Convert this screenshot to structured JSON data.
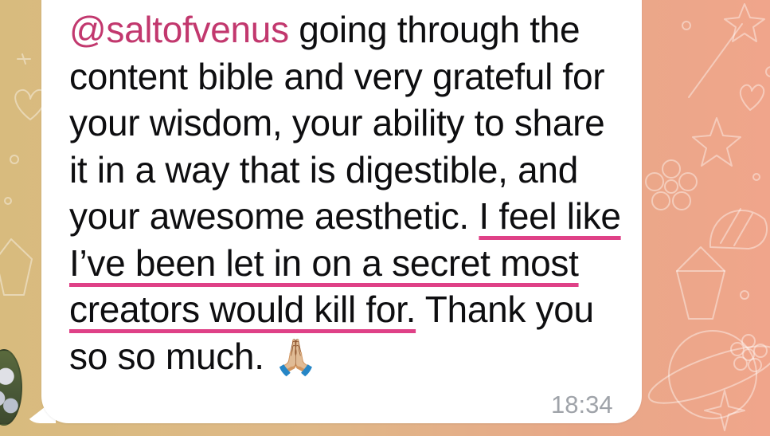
{
  "message": {
    "mention": "@saltofvenus",
    "text_before_highlight": " going through the content bible and very grateful for your wisdom, your ability to share it in a way that is digestible, and your awesome aesthetic. ",
    "highlighted_text": "I feel like I’ve been let in on a secret most creators would kill for.",
    "text_after_highlight": " Thank you so so much. ",
    "emoji": "🙏🏼",
    "timestamp": "18:34"
  },
  "colors": {
    "mention": "#c2386e",
    "highlight_underline": "#df4187",
    "timestamp": "#9fa3a9",
    "bubble": "#ffffff"
  },
  "icons": [
    "star-icon",
    "heart-icon",
    "crystal-icon",
    "flower-icon",
    "seashell-icon",
    "magic-wand-icon",
    "planet-icon",
    "sparkle-icon"
  ]
}
